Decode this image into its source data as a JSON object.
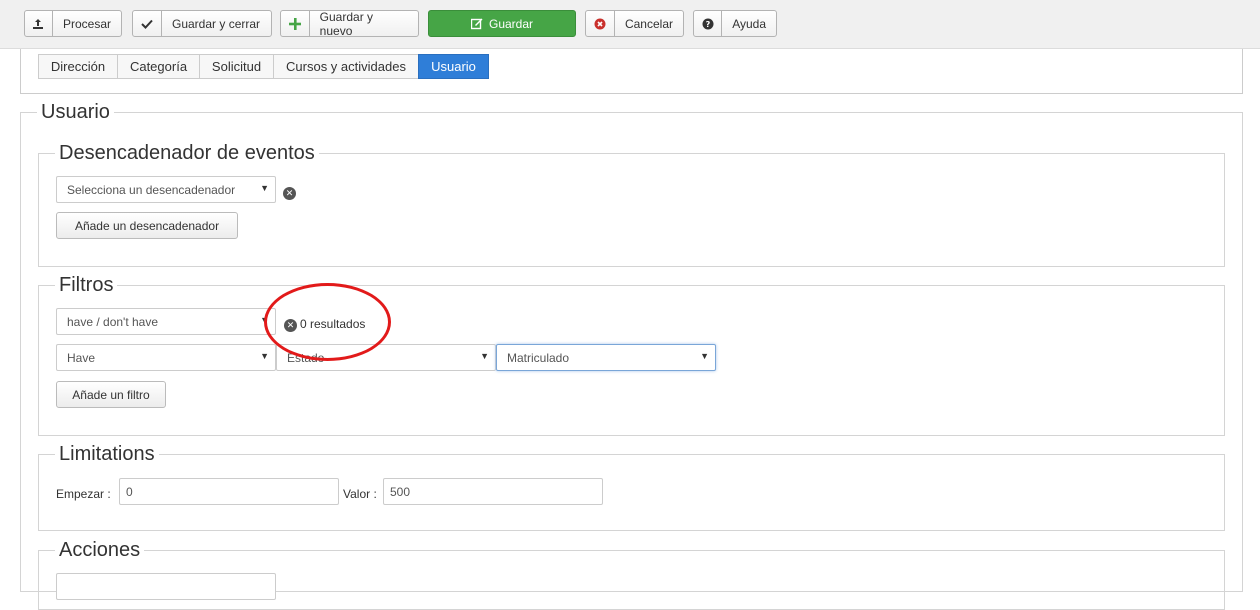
{
  "toolbar": {
    "process_label": "Procesar",
    "save_close_label": "Guardar y cerrar",
    "save_new_label": "Guardar y nuevo",
    "save_label": "Guardar",
    "cancel_label": "Cancelar",
    "help_label": "Ayuda"
  },
  "tabs": [
    {
      "label": "Dirección"
    },
    {
      "label": "Categoría"
    },
    {
      "label": "Solicitud"
    },
    {
      "label": "Cursos y actividades"
    },
    {
      "label": "Usuario"
    }
  ],
  "active_tab": "Usuario",
  "section_title": "Usuario",
  "triggers": {
    "title": "Desencadenador de eventos",
    "select_value": "Selecciona un desencadenador",
    "add_button": "Añade un desencadenador"
  },
  "filters": {
    "title": "Filtros",
    "mode_value": "have / don't have",
    "results_text": "0 resultados",
    "have_value": "Have",
    "field_value": "Estado",
    "status_value": "Matriculado",
    "add_button": "Añade un filtro"
  },
  "limitations": {
    "title": "Limitations",
    "start_label": "Empezar :",
    "start_value": "0",
    "value_label": "Valor :",
    "value_value": "500"
  },
  "actions": {
    "title": "Acciones"
  },
  "colors": {
    "save_green": "#46a546",
    "active_tab_blue": "#2f7ed8",
    "annotation_red": "#e21a1a"
  }
}
